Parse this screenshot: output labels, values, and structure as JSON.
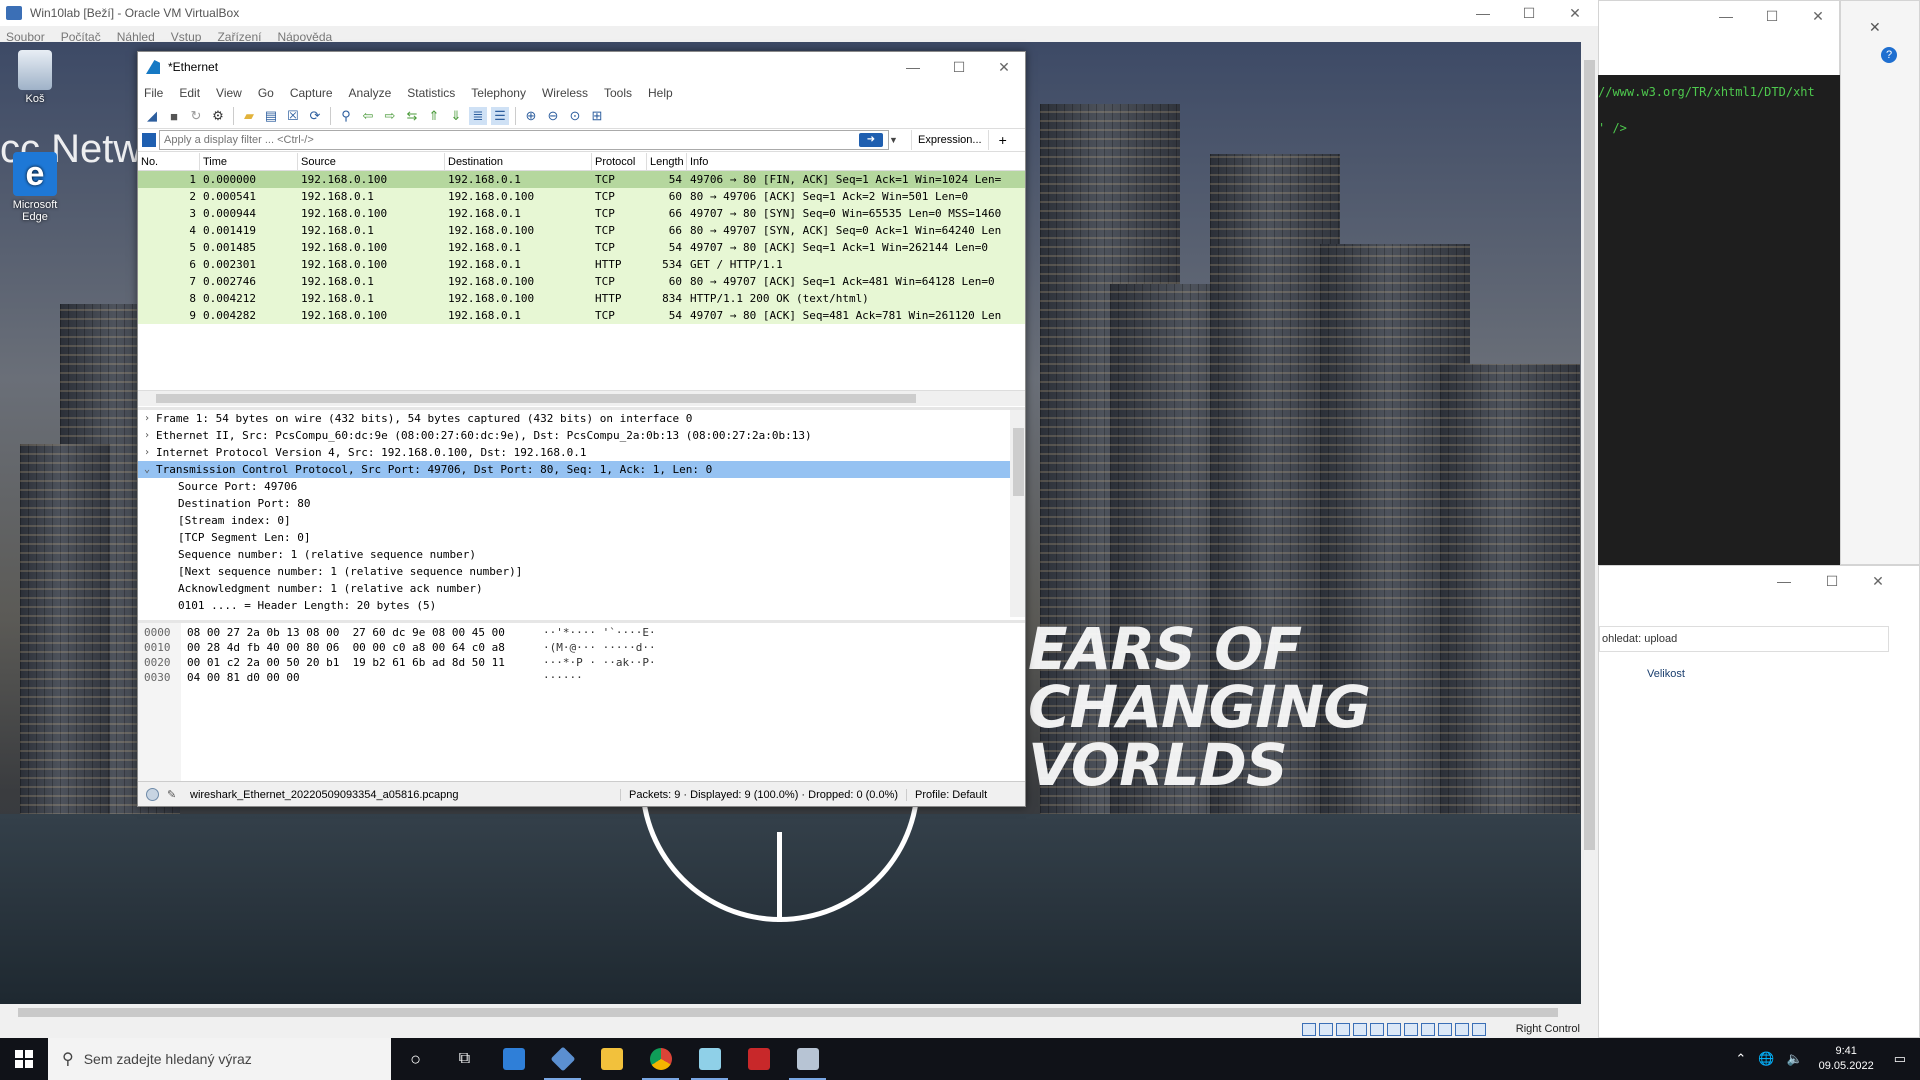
{
  "vbox": {
    "title": "Win10lab [Beží] - Oracle VM VirtualBox",
    "menu": [
      "Soubor",
      "Počítač",
      "Náhled",
      "Vstup",
      "Zařízení",
      "Nápověda"
    ],
    "host_key": "Right Control"
  },
  "desktop": {
    "icons": [
      {
        "label": "Koš",
        "icon": "recycle-bin-icon"
      },
      {
        "label": "Microsoft Edge",
        "icon": "edge-icon"
      }
    ],
    "background_text": "cc Netw",
    "promo_lines": [
      "EARS OF",
      "CHANGING",
      "VORLDS"
    ]
  },
  "host_windows": {
    "code_lines": [
      "//www.w3.org/TR/xhtml1/DTD/xht",
      "",
      "' />"
    ],
    "explorer_search": "ohledat: upload",
    "explorer_column": "Velikost"
  },
  "wireshark": {
    "title": "*Ethernet",
    "menu": [
      "File",
      "Edit",
      "View",
      "Go",
      "Capture",
      "Analyze",
      "Statistics",
      "Telephony",
      "Wireless",
      "Tools",
      "Help"
    ],
    "filter_placeholder": "Apply a display filter ... <Ctrl-/>",
    "expression_label": "Expression...",
    "plus_label": "+",
    "columns": [
      "No.",
      "Time",
      "Source",
      "Destination",
      "Protocol",
      "Length",
      "Info"
    ],
    "packets": [
      {
        "no": "1",
        "time": "0.000000",
        "src": "192.168.0.100",
        "dst": "192.168.0.1",
        "proto": "TCP",
        "len": "54",
        "info": "49706 → 80 [FIN, ACK] Seq=1 Ack=1 Win=1024 Len="
      },
      {
        "no": "2",
        "time": "0.000541",
        "src": "192.168.0.1",
        "dst": "192.168.0.100",
        "proto": "TCP",
        "len": "60",
        "info": "80 → 49706 [ACK] Seq=1 Ack=2 Win=501 Len=0"
      },
      {
        "no": "3",
        "time": "0.000944",
        "src": "192.168.0.100",
        "dst": "192.168.0.1",
        "proto": "TCP",
        "len": "66",
        "info": "49707 → 80 [SYN] Seq=0 Win=65535 Len=0 MSS=1460"
      },
      {
        "no": "4",
        "time": "0.001419",
        "src": "192.168.0.1",
        "dst": "192.168.0.100",
        "proto": "TCP",
        "len": "66",
        "info": "80 → 49707 [SYN, ACK] Seq=0 Ack=1 Win=64240 Len"
      },
      {
        "no": "5",
        "time": "0.001485",
        "src": "192.168.0.100",
        "dst": "192.168.0.1",
        "proto": "TCP",
        "len": "54",
        "info": "49707 → 80 [ACK] Seq=1 Ack=1 Win=262144 Len=0"
      },
      {
        "no": "6",
        "time": "0.002301",
        "src": "192.168.0.100",
        "dst": "192.168.0.1",
        "proto": "HTTP",
        "len": "534",
        "info": "GET / HTTP/1.1"
      },
      {
        "no": "7",
        "time": "0.002746",
        "src": "192.168.0.1",
        "dst": "192.168.0.100",
        "proto": "TCP",
        "len": "60",
        "info": "80 → 49707 [ACK] Seq=1 Ack=481 Win=64128 Len=0"
      },
      {
        "no": "8",
        "time": "0.004212",
        "src": "192.168.0.1",
        "dst": "192.168.0.100",
        "proto": "HTTP",
        "len": "834",
        "info": "HTTP/1.1 200 OK  (text/html)"
      },
      {
        "no": "9",
        "time": "0.004282",
        "src": "192.168.0.100",
        "dst": "192.168.0.1",
        "proto": "TCP",
        "len": "54",
        "info": "49707 → 80 [ACK] Seq=481 Ack=781 Win=261120 Len"
      }
    ],
    "details": [
      {
        "twisty": "›",
        "text": "Frame 1: 54 bytes on wire (432 bits), 54 bytes captured (432 bits) on interface 0"
      },
      {
        "twisty": "›",
        "text": "Ethernet II, Src: PcsCompu_60:dc:9e (08:00:27:60:dc:9e), Dst: PcsCompu_2a:0b:13 (08:00:27:2a:0b:13)"
      },
      {
        "twisty": "›",
        "text": "Internet Protocol Version 4, Src: 192.168.0.100, Dst: 192.168.0.1"
      },
      {
        "twisty": "⌄",
        "text": "Transmission Control Protocol, Src Port: 49706, Dst Port: 80, Seq: 1, Ack: 1, Len: 0"
      }
    ],
    "detail_children": [
      "Source Port: 49706",
      "Destination Port: 80",
      "[Stream index: 0]",
      "[TCP Segment Len: 0]",
      "Sequence number: 1    (relative sequence number)",
      "[Next sequence number: 1    (relative sequence number)]",
      "Acknowledgment number: 1    (relative ack number)",
      "0101 .... = Header Length: 20 bytes (5)"
    ],
    "bytes": [
      {
        "off": "0000",
        "hex": "08 00 27 2a 0b 13 08 00  27 60 dc 9e 08 00 45 00",
        "ascii": "··'*···· '`····E·"
      },
      {
        "off": "0010",
        "hex": "00 28 4d fb 40 00 80 06  00 00 c0 a8 00 64 c0 a8",
        "ascii": "·(M·@··· ·····d··"
      },
      {
        "off": "0020",
        "hex": "00 01 c2 2a 00 50 20 b1  19 b2 61 6b ad 8d 50 11",
        "ascii": "···*·P · ··ak··P·"
      },
      {
        "off": "0030",
        "hex": "04 00 81 d0 00 00",
        "ascii": "······"
      }
    ],
    "status": {
      "file": "wireshark_Ethernet_20220509093354_a05816.pcapng",
      "packets": "Packets: 9 · Displayed: 9 (100.0%) · Dropped: 0 (0.0%)",
      "profile": "Profile: Default"
    }
  },
  "taskbar": {
    "search_placeholder": "Sem zadejte hledaný výraz",
    "time": "9:41",
    "date": "09.05.2022"
  }
}
